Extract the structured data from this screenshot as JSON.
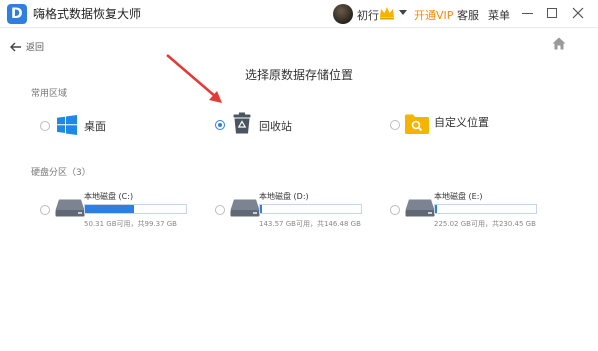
{
  "app": {
    "title": "嗨格式数据恢复大师"
  },
  "header": {
    "username": "初行",
    "vip_label": "开通VIP",
    "service_label": "客服",
    "menu_label": "菜单"
  },
  "nav": {
    "back_label": "返回"
  },
  "page_title": "选择原数据存储位置",
  "common": {
    "label": "常用区域",
    "options": [
      {
        "label": "桌面",
        "icon": "windows-logo-icon",
        "selected": false
      },
      {
        "label": "回收站",
        "icon": "recycle-bin-icon",
        "selected": true
      },
      {
        "label": "自定义位置",
        "icon": "folder-search-icon",
        "selected": false
      }
    ]
  },
  "disks": {
    "label": "硬盘分区（3）",
    "items": [
      {
        "name": "本地磁盘 (C:)",
        "info": "50.31 GB可用，共99.37 GB",
        "used_fraction": 0.49
      },
      {
        "name": "本地磁盘 (D:)",
        "info": "143.57 GB可用，共146.48 GB",
        "used_fraction": 0.02
      },
      {
        "name": "本地磁盘 (E:)",
        "info": "225.02 GB可用，共230.45 GB",
        "used_fraction": 0.02
      }
    ]
  },
  "colors": {
    "accent": "#2f7fe0",
    "vip": "#ff8a00",
    "annotation_arrow": "#e53935"
  }
}
